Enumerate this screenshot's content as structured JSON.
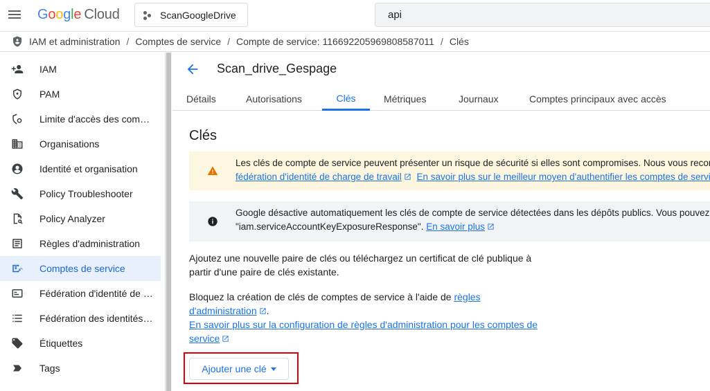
{
  "topbar": {
    "logo_google": "Google",
    "logo_cloud": "Cloud",
    "project_name": "ScanGoogleDrive",
    "search_value": "api"
  },
  "breadcrumb": [
    "IAM et administration",
    "Comptes de service",
    "Compte de service: 116692205969808587011",
    "Clés"
  ],
  "sidebar": {
    "items": [
      {
        "label": "IAM",
        "icon": "person-add-icon"
      },
      {
        "label": "PAM",
        "icon": "shield-icon"
      },
      {
        "label": "Limite d'accès des comptes principaux",
        "icon": "boundary-icon"
      },
      {
        "label": "Organisations",
        "icon": "building-icon"
      },
      {
        "label": "Identité et organisation",
        "icon": "account-circle-icon"
      },
      {
        "label": "Policy Troubleshooter",
        "icon": "wrench-icon"
      },
      {
        "label": "Policy Analyzer",
        "icon": "document-search-icon"
      },
      {
        "label": "Règles d'administration",
        "icon": "list-alt-icon"
      },
      {
        "label": "Comptes de service",
        "icon": "service-account-icon",
        "active": true
      },
      {
        "label": "Fédération d'identité de charge de travail",
        "icon": "id-card-icon"
      },
      {
        "label": "Fédération des identités de personnel",
        "icon": "list-icon"
      },
      {
        "label": "Étiquettes",
        "icon": "label-icon"
      },
      {
        "label": "Tags",
        "icon": "tag-arrow-icon"
      }
    ]
  },
  "main": {
    "title": "Scan_drive_Gespage",
    "tabs": [
      "Détails",
      "Autorisations",
      "Clés",
      "Métriques",
      "Journaux",
      "Comptes principaux avec accès"
    ],
    "active_tab": "Clés",
    "section_title": "Clés",
    "warning": {
      "line1": "Les clés de compte de service peuvent présenter un risque de sécurité si elles sont compromises. Nous vous recommandons",
      "link1": "fédération d'identité de charge de travail",
      "link2": "En savoir plus sur le meilleur moyen d'authentifier les comptes de service"
    },
    "info": {
      "line1": "Google désactive automatiquement les clés de compte de service détectées dans les dépôts publics. Vous pouvez",
      "line2": "\"iam.serviceAccountKeyExposureResponse\".",
      "link": "En savoir plus"
    },
    "paragraph1": "Ajoutez une nouvelle paire de clés ou téléchargez un certificat de clé publique à partir d'une paire de clés existante.",
    "paragraph2_text": "Bloquez la création de clés de comptes de service à l'aide de",
    "paragraph2_link1a": "règles",
    "paragraph2_link1b": "d'administration",
    "paragraph2_link2a": "En savoir plus sur la configuration de règles d'administration pour les comptes de",
    "paragraph2_link2b": "service",
    "add_key_label": "Ajouter une clé"
  },
  "colors": {
    "accent": "#1a73e8",
    "active_nav_bg": "#e8f0fe",
    "warning_bg": "#fef7e0",
    "warning_icon": "#e37400",
    "info_bg": "#f1f3f4",
    "highlight": "#e00000"
  }
}
